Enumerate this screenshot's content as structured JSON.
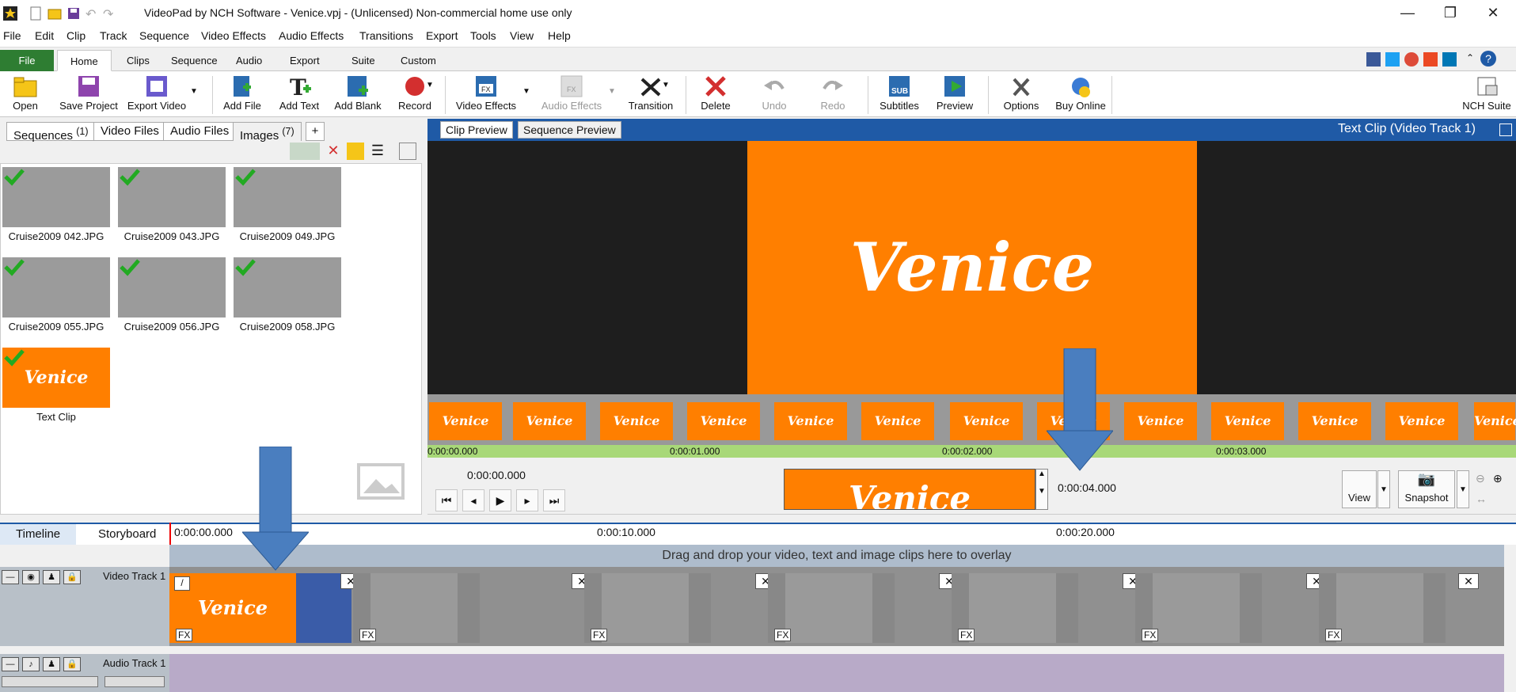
{
  "window": {
    "title": "VideoPad by NCH Software - Venice.vpj - (Unlicensed) Non-commercial home use only",
    "minimize": "—",
    "restore": "❐",
    "close": "✕"
  },
  "menubar": [
    "File",
    "Edit",
    "Clip",
    "Track",
    "Sequence",
    "Video Effects",
    "Audio Effects",
    "Transitions",
    "Export",
    "Tools",
    "View",
    "Help"
  ],
  "ribbon_tabs": [
    "File",
    "Home",
    "Clips",
    "Sequence",
    "Audio",
    "Export",
    "Suite",
    "Custom"
  ],
  "toolbar": {
    "open": "Open",
    "save_project": "Save Project",
    "export_video": "Export Video",
    "add_file": "Add File",
    "add_text": "Add Text",
    "add_blank": "Add Blank",
    "record": "Record",
    "video_effects": "Video Effects",
    "audio_effects": "Audio Effects",
    "transition": "Transition",
    "delete": "Delete",
    "undo": "Undo",
    "redo": "Redo",
    "subtitles": "Subtitles",
    "preview": "Preview",
    "options": "Options",
    "buy_online": "Buy Online",
    "nch_suite": "NCH Suite"
  },
  "bin_tabs": {
    "sequences": "Sequences",
    "sequences_count": "(1)",
    "video_files": "Video Files",
    "audio_files": "Audio Files",
    "images": "Images",
    "images_count": "(7)",
    "add": "+"
  },
  "media_items": [
    {
      "name": "Cruise2009 042.JPG"
    },
    {
      "name": "Cruise2009 043.JPG"
    },
    {
      "name": "Cruise2009 049.JPG"
    },
    {
      "name": "Cruise2009 055.JPG"
    },
    {
      "name": "Cruise2009 056.JPG"
    },
    {
      "name": "Cruise2009 058.JPG"
    },
    {
      "name": "Text Clip",
      "thumb_text": "Venice"
    }
  ],
  "preview": {
    "tab_clip": "Clip Preview",
    "tab_sequence": "Sequence Preview",
    "title": "Text Clip (Video Track 1)",
    "card_text": "Venice",
    "film_text": "Venice",
    "ruler": [
      "0:00:00.000",
      "0:00:01.000",
      "0:00:02.000",
      "0:00:03.000"
    ],
    "current_time": "0:00:00.000",
    "duration": "0:00:04.000",
    "view_label": "View",
    "snapshot_label": "Snapshot"
  },
  "timeline": {
    "tab_timeline": "Timeline",
    "tab_storyboard": "Storyboard",
    "ruler": [
      "0:00:00.000",
      "0:00:10.000",
      "0:00:20.000"
    ],
    "overlay_hint": "Drag and drop your video, text and image clips here to overlay",
    "video_track": "Video Track 1",
    "audio_track": "Audio Track 1",
    "text_clip": "Venice",
    "fx": "FX"
  },
  "colors": {
    "accent_blue": "#1f5aa6",
    "orange": "#ff7f00",
    "file_green": "#2e7d32",
    "arrow_blue": "#4a7ebf"
  }
}
